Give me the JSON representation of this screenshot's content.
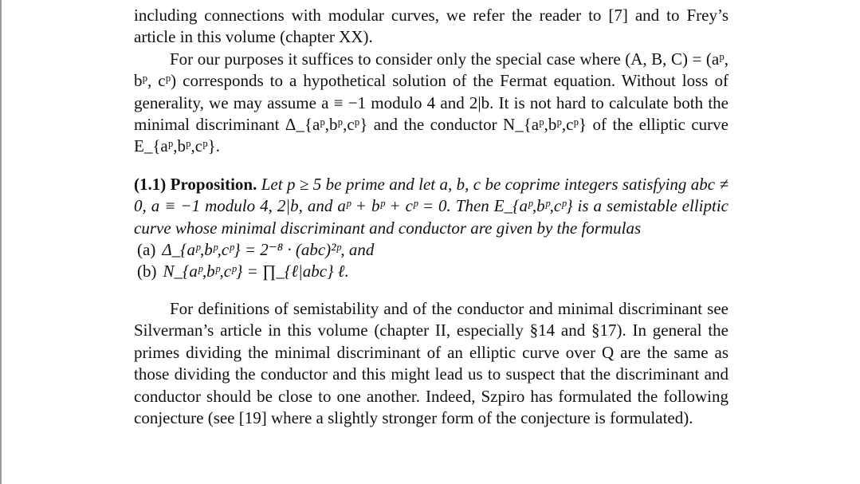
{
  "para1": {
    "lines": "including connections with modular curves, we refer the reader to [7] and to Frey’s article in this volume (chapter XX)."
  },
  "para2": {
    "text": "For our purposes it suffices to consider only the special case where (A, B, C) = (aᵖ, bᵖ, cᵖ) corresponds to a hypothetical solution of the Fermat equation. Without loss of generality, we may assume a ≡ −1 modulo 4 and 2|b. It is not hard to calculate both the minimal discriminant Δ_{aᵖ,bᵖ,cᵖ} and the conductor N_{aᵖ,bᵖ,cᵖ} of the elliptic curve E_{aᵖ,bᵖ,cᵖ}."
  },
  "proposition": {
    "number": "(1.1)",
    "title": "Proposition.",
    "body": "Let p ≥ 5 be prime and let a, b, c be coprime integers satisfying abc ≠ 0, a ≡ −1 modulo 4, 2|b, and aᵖ + bᵖ + cᵖ = 0. Then E_{aᵖ,bᵖ,cᵖ} is a semistable elliptic curve whose minimal discriminant and conductor are given by the formulas",
    "items": [
      {
        "label": "(a)",
        "formula": "Δ_{aᵖ,bᵖ,cᵖ} = 2⁻⁸ · (abc)²ᵖ, and"
      },
      {
        "label": "(b)",
        "formula": "N_{aᵖ,bᵖ,cᵖ} = ∏_{ℓ|abc} ℓ."
      }
    ]
  },
  "para3": {
    "text": "For definitions of semistability and of the conductor and minimal discriminant see Silverman’s article in this volume (chapter II, especially §14 and §17). In general the primes dividing the minimal discriminant of an elliptic curve over Q are the same as those dividing the conductor and this might lead us to suspect that the discriminant and conductor should be close to one another. Indeed, Szpiro has formulated the following conjecture (see [19] where a slightly stronger form of the conjecture is formulated)."
  }
}
